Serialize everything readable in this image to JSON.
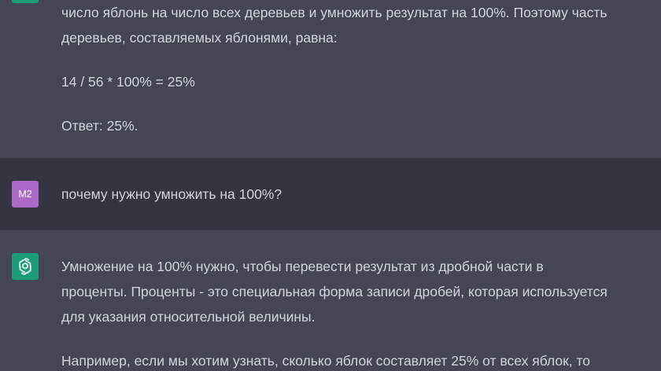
{
  "colors": {
    "assistant_bg": "#444654",
    "user_bg": "#343541",
    "text": "#d1d5db",
    "user_avatar_bg": "#ab68c7",
    "bot_avatar_bg": "#1a9d78"
  },
  "messages": {
    "prev_answer": {
      "line1": "число яблонь на число всех деревьев и умножить результат на 100%. Поэтому часть",
      "line2": "деревьев, составляемых яблонями, равна:",
      "formula": "14 / 56 * 100% = 25%",
      "answer": "Ответ: 25%."
    },
    "user_question": {
      "avatar_label": "M2",
      "text": "почему нужно умножить на 100%?"
    },
    "bot_answer": {
      "avatar_icon": "openai-logo-icon",
      "line1": "Умножение на 100% нужно, чтобы перевести результат из дробной части в",
      "line2": "проценты. Проценты - это специальная форма записи дробей, которая используется",
      "line3": "для указания относительной величины.",
      "line4": "Например, если мы хотим узнать, сколько яблок составляет 25% от всех яблок, то"
    }
  }
}
